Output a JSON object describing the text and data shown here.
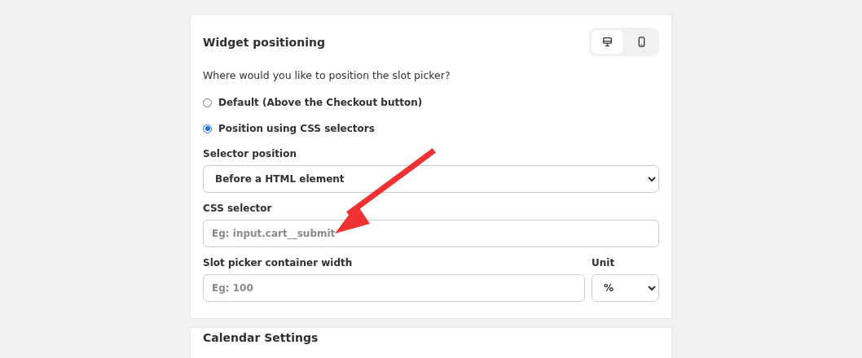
{
  "card": {
    "title": "Widget positioning",
    "devices": [
      {
        "kind": "desktop",
        "selected": true
      },
      {
        "kind": "mobile",
        "selected": false
      }
    ],
    "question": "Where would you like to position the slot picker?",
    "options": [
      {
        "label": "Default (Above the Checkout button)",
        "selected": false
      },
      {
        "label": "Position using CSS selectors",
        "selected": true
      }
    ],
    "selector_position": {
      "label": "Selector position",
      "value": "Before a HTML element"
    },
    "css_selector": {
      "label": "CSS selector",
      "placeholder": "Eg: input.cart__submit"
    },
    "width": {
      "label": "Slot picker container width",
      "placeholder": "Eg: 100"
    },
    "unit": {
      "label": "Unit",
      "value": "%"
    }
  },
  "next_card": {
    "title": "Calendar Settings"
  }
}
